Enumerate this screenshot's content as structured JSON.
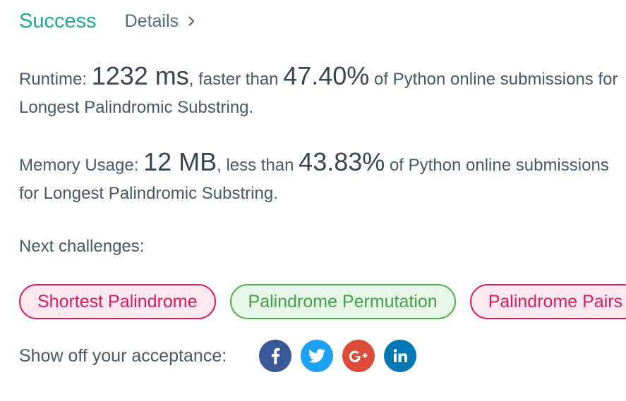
{
  "header": {
    "status": "Success",
    "details_label": "Details"
  },
  "runtime": {
    "label": "Runtime: ",
    "value": "1232 ms",
    "comparison": ", faster than ",
    "percent": "47.40%",
    "suffix": " of Python online submissions for",
    "problem_line": "Longest Palindromic Substring."
  },
  "memory": {
    "label": "Memory Usage: ",
    "value": "12 MB",
    "comparison": ", less than ",
    "percent": "43.83%",
    "suffix": " of Python online submissions",
    "problem_line": "for Longest Palindromic Substring."
  },
  "next": {
    "label": "Next challenges:",
    "challenges": [
      {
        "title": "Shortest Palindrome",
        "difficulty": "hard"
      },
      {
        "title": "Palindrome Permutation",
        "difficulty": "easy"
      },
      {
        "title": "Palindrome Pairs",
        "difficulty": "hard"
      }
    ]
  },
  "share": {
    "label": "Show off your acceptance:",
    "icons": [
      "facebook-icon",
      "twitter-icon",
      "google-plus-icon",
      "linkedin-icon"
    ],
    "colors": {
      "facebook": "#3b5998",
      "twitter": "#1da1f2",
      "google_plus": "#dd4b39",
      "linkedin": "#0077b5"
    }
  },
  "colors": {
    "success": "#1fa88e",
    "hard": "#d81b60",
    "easy": "#43a047"
  }
}
